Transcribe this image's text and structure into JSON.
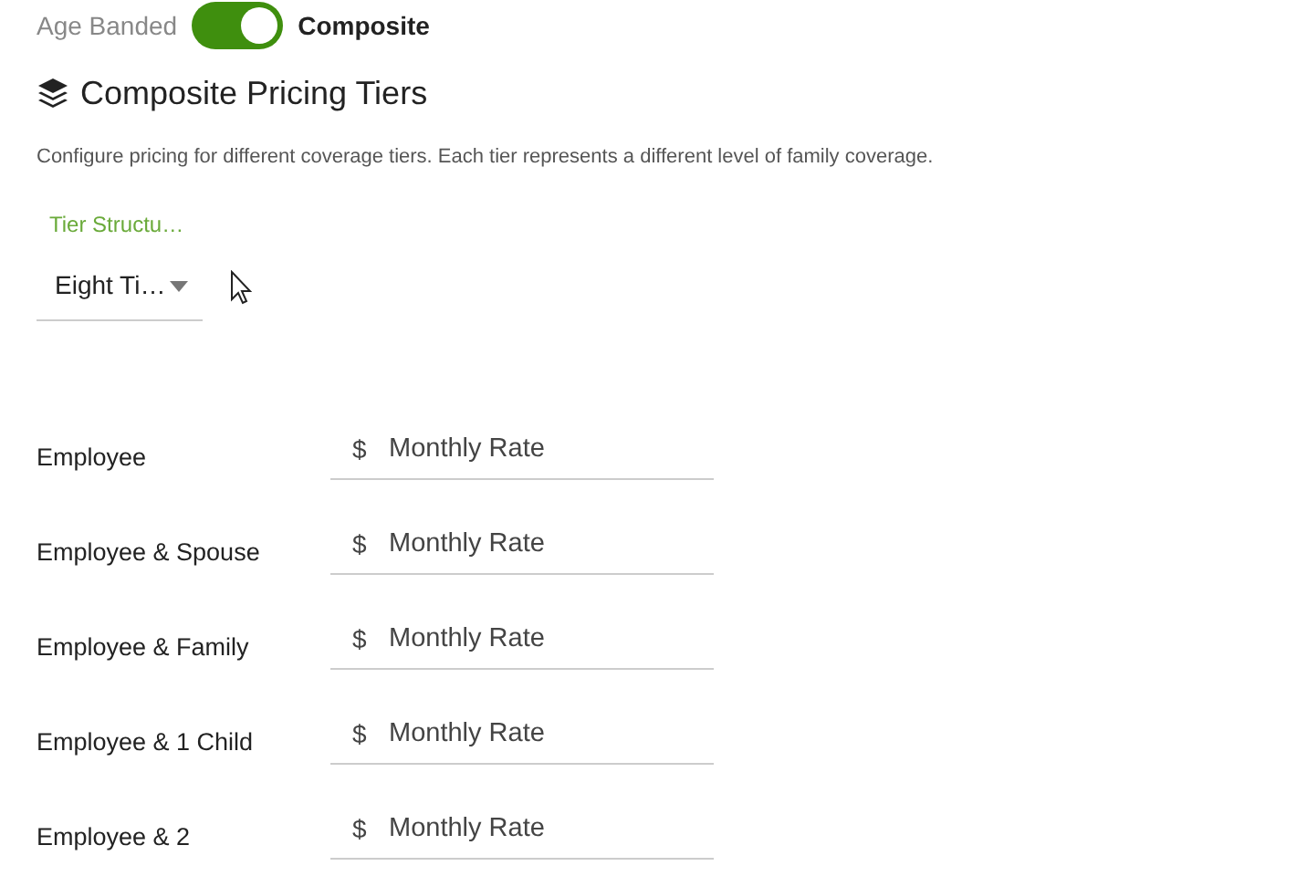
{
  "pricing_mode": {
    "left_label": "Age Banded",
    "right_label": "Composite",
    "on": true
  },
  "section": {
    "title": "Composite Pricing Tiers",
    "description": "Configure pricing for different coverage tiers. Each tier represents a different level of family coverage."
  },
  "tier_structure": {
    "label": "Tier Structu…",
    "value": "Eight Ti…"
  },
  "tiers": [
    {
      "label": "Employee",
      "currency": "$",
      "placeholder": "Monthly Rate"
    },
    {
      "label": "Employee & Spouse",
      "currency": "$",
      "placeholder": "Monthly Rate"
    },
    {
      "label": "Employee & Family",
      "currency": "$",
      "placeholder": "Monthly Rate"
    },
    {
      "label": "Employee & 1 Child",
      "currency": "$",
      "placeholder": "Monthly Rate"
    },
    {
      "label": "Employee & 2",
      "currency": "$",
      "placeholder": "Monthly Rate"
    }
  ]
}
